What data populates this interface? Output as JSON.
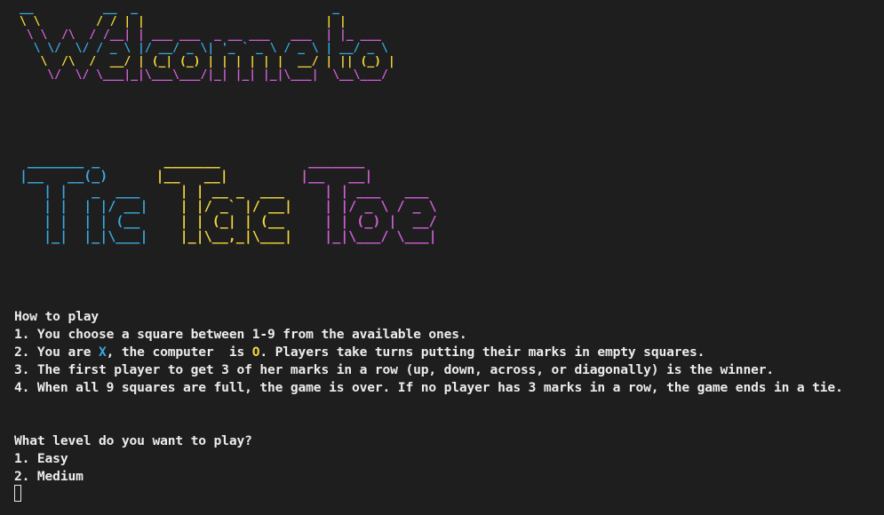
{
  "banner": {
    "welcome_text": "Welcome to",
    "title_text": "Tic Tac Toe",
    "colors": {
      "magenta": "#d05fd8",
      "yellow": "#f5d83a",
      "cyan": "#39a9e0"
    }
  },
  "instructions": {
    "heading": "How to play",
    "step1": "1. You choose a square between 1-9 from the available ones.",
    "step2_prefix": "2. You are ",
    "player_mark": "X",
    "step2_mid": ", the computer  is ",
    "computer_mark": "O",
    "step2_suffix": ". Players take turns putting their marks in empty squares.",
    "step3": "3. The first player to get 3 of her marks in a row (up, down, across, or diagonally) is the winner.",
    "step4": "4. When all 9 squares are full, the game is over. If no player has 3 marks in a row, the game ends in a tie."
  },
  "level_prompt": {
    "question": "What level do you want to play?",
    "options": [
      "1. Easy",
      "2. Medium"
    ]
  },
  "mark_colors": {
    "player_x": "#39a9e0",
    "computer_o": "#f5d83a"
  }
}
